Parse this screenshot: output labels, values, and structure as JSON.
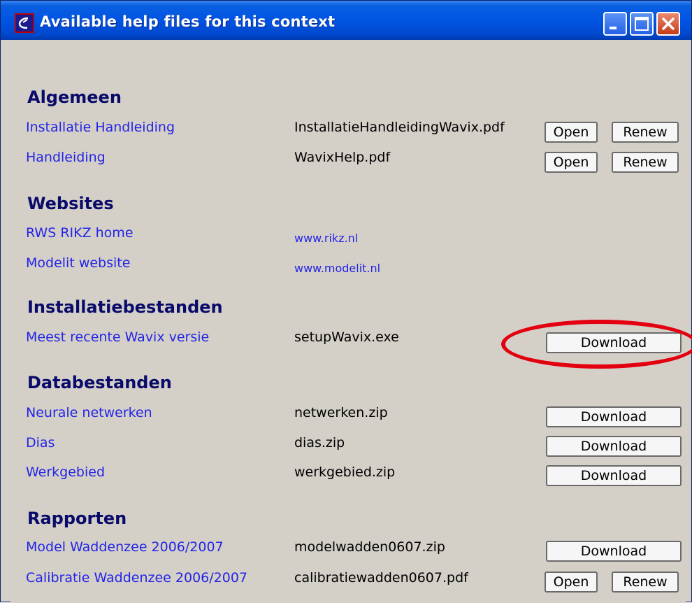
{
  "window": {
    "title": "Available help files for this context",
    "controls": {
      "minimize": "minimize-icon",
      "maximize": "maximize-icon",
      "close": "close-icon"
    }
  },
  "sections": {
    "algemeen": {
      "heading": "Algemeen",
      "rows": [
        {
          "label": "Installatie Handleiding",
          "file": "InstallatieHandleidingWavix.pdf",
          "open": "Open",
          "renew": "Renew"
        },
        {
          "label": "Handleiding",
          "file": "WavixHelp.pdf",
          "open": "Open",
          "renew": "Renew"
        }
      ]
    },
    "websites": {
      "heading": "Websites",
      "rows": [
        {
          "label": "RWS RIKZ home",
          "link": "www.rikz.nl"
        },
        {
          "label": "Modelit website",
          "link": "www.modelit.nl"
        }
      ]
    },
    "installatie": {
      "heading": "Installatiebestanden",
      "rows": [
        {
          "label": "Meest recente Wavix versie",
          "file": "setupWavix.exe",
          "download": "Download"
        }
      ]
    },
    "data": {
      "heading": "Databestanden",
      "rows": [
        {
          "label": "Neurale netwerken",
          "file": "netwerken.zip",
          "download": "Download"
        },
        {
          "label": "Dias",
          "file": "dias.zip",
          "download": "Download"
        },
        {
          "label": "Werkgebied",
          "file": "werkgebied.zip",
          "download": "Download"
        }
      ]
    },
    "rapporten": {
      "heading": "Rapporten",
      "rows": [
        {
          "label": "Model Waddenzee 2006/2007",
          "file": "modelwadden0607.zip",
          "download": "Download"
        },
        {
          "label": "Calibratie Waddenzee 2006/2007",
          "file": "calibratiewadden0607.pdf",
          "open": "Open",
          "renew": "Renew"
        }
      ]
    }
  },
  "colors": {
    "accent": "#0054e3",
    "link": "#2424e6",
    "heading": "#0a0a6a",
    "highlight": "#e3000f",
    "panel": "#d4d0c8"
  }
}
